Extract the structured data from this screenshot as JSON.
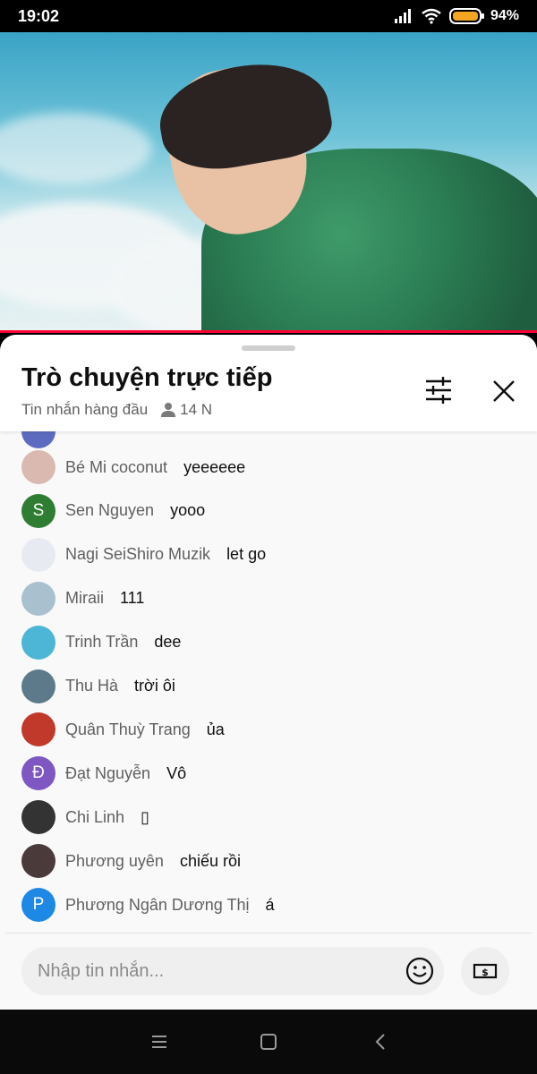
{
  "status": {
    "time": "19:02",
    "battery": "94%"
  },
  "chat": {
    "title": "Trò chuyện trực tiếp",
    "mode": "Tin nhắn hàng đầu",
    "viewers": "14 N",
    "input_placeholder": "Nhập tin nhắn...",
    "messages": [
      {
        "author": "Bé Mi coconut",
        "text": "yeeeeee",
        "avatar_letter": "",
        "avatar_color": "#d9b9b0"
      },
      {
        "author": "Sen Nguyen",
        "text": "yooo",
        "avatar_letter": "S",
        "avatar_color": "#2e7d32"
      },
      {
        "author": "Nagi SeiShiro Muzik",
        "text": "let go",
        "avatar_letter": "",
        "avatar_color": "#e8eaf2"
      },
      {
        "author": "Miraii",
        "text": "111",
        "avatar_letter": "",
        "avatar_color": "#a9c0cf"
      },
      {
        "author": "Trinh Trần",
        "text": "dee",
        "avatar_letter": "",
        "avatar_color": "#4db6d6"
      },
      {
        "author": "Thu Hà",
        "text": "trời ôi",
        "avatar_letter": "",
        "avatar_color": "#5d7a8a"
      },
      {
        "author": "Quân Thuỳ Trang",
        "text": "ủa",
        "avatar_letter": "",
        "avatar_color": "#c0392b"
      },
      {
        "author": "Đạt Nguyễn",
        "text": "Vô",
        "avatar_letter": "Đ",
        "avatar_color": "#7e57c2"
      },
      {
        "author": "Chi Linh",
        "text": "▯",
        "avatar_letter": "",
        "avatar_color": "#333333"
      },
      {
        "author": "Phương uyên",
        "text": "chiếu rồi",
        "avatar_letter": "",
        "avatar_color": "#4a3a3a"
      },
      {
        "author": "Phương Ngân Dương Thị",
        "text": "á",
        "avatar_letter": "P",
        "avatar_color": "#1e88e5"
      }
    ]
  },
  "colors": {
    "accent_red": "#ff0033"
  },
  "icons": {
    "filter": "sliders-icon",
    "close": "close-icon",
    "emoji": "emoji-icon",
    "donate": "dollar-icon"
  }
}
